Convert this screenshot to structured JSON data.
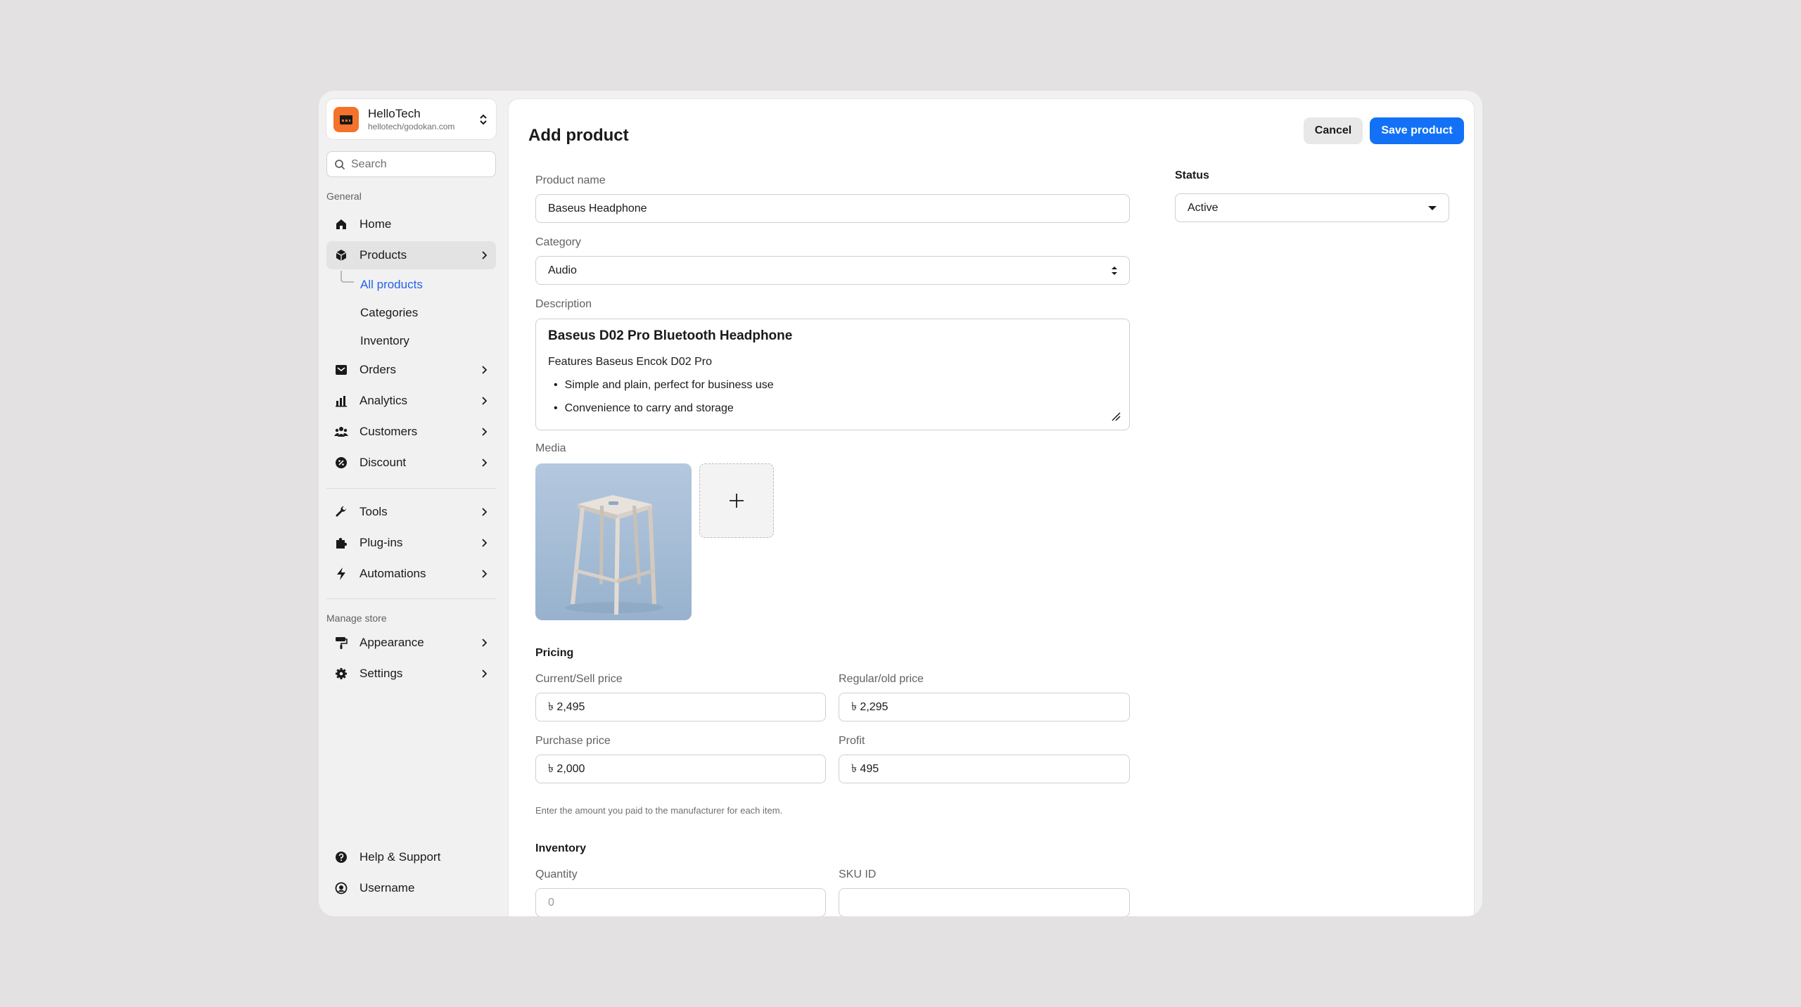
{
  "store": {
    "name": "HelloTech",
    "url": "hellotech/godokan.com"
  },
  "search": {
    "placeholder": "Search"
  },
  "sidebar": {
    "general_label": "General",
    "manage_label": "Manage store",
    "items": [
      {
        "label": "Home",
        "icon": "home-icon"
      },
      {
        "label": "Products",
        "icon": "box-icon"
      },
      {
        "label": "Orders",
        "icon": "inbox-icon"
      },
      {
        "label": "Analytics",
        "icon": "bar-chart-icon"
      },
      {
        "label": "Customers",
        "icon": "users-icon"
      },
      {
        "label": "Discount",
        "icon": "discount-icon"
      },
      {
        "label": "Tools",
        "icon": "wrench-icon"
      },
      {
        "label": "Plug-ins",
        "icon": "puzzle-icon"
      },
      {
        "label": "Automations",
        "icon": "bolt-icon"
      },
      {
        "label": "Appearance",
        "icon": "paint-roller-icon"
      },
      {
        "label": "Settings",
        "icon": "gear-icon"
      }
    ],
    "product_subitems": [
      "All products",
      "Categories",
      "Inventory"
    ],
    "footer": [
      {
        "label": "Help & Support",
        "icon": "help-icon"
      },
      {
        "label": "Username",
        "icon": "user-circle-icon"
      }
    ]
  },
  "page": {
    "title": "Add product",
    "cancel_label": "Cancel",
    "save_label": "Save product"
  },
  "form": {
    "product_name_label": "Product name",
    "product_name_value": "Baseus Headphone",
    "category_label": "Category",
    "category_value": "Audio",
    "description_label": "Description",
    "description": {
      "title": "Baseus D02 Pro Bluetooth Headphone",
      "line": "Features Baseus Encok D02 Pro",
      "bullets": [
        "Simple and plain, perfect for business use",
        "Convenience to carry and storage"
      ]
    },
    "media_label": "Media",
    "pricing_heading": "Pricing",
    "sell_price_label": "Current/Sell price",
    "sell_price_value": "৳ 2,495",
    "regular_price_label": "Regular/old price",
    "regular_price_value": "৳ 2,295",
    "purchase_price_label": "Purchase price",
    "purchase_price_value": "৳ 2,000",
    "profit_label": "Profit",
    "profit_value": "৳ 495",
    "purchase_helper": "Enter the amount you paid to the manufacturer for each item.",
    "inventory_heading": "Inventory",
    "quantity_label": "Quantity",
    "quantity_placeholder": "0",
    "sku_label": "SKU ID"
  },
  "status": {
    "label": "Status",
    "value": "Active"
  },
  "colors": {
    "accent": "#1271f6",
    "brand": "#f4722b",
    "active_link": "#2463eb"
  }
}
